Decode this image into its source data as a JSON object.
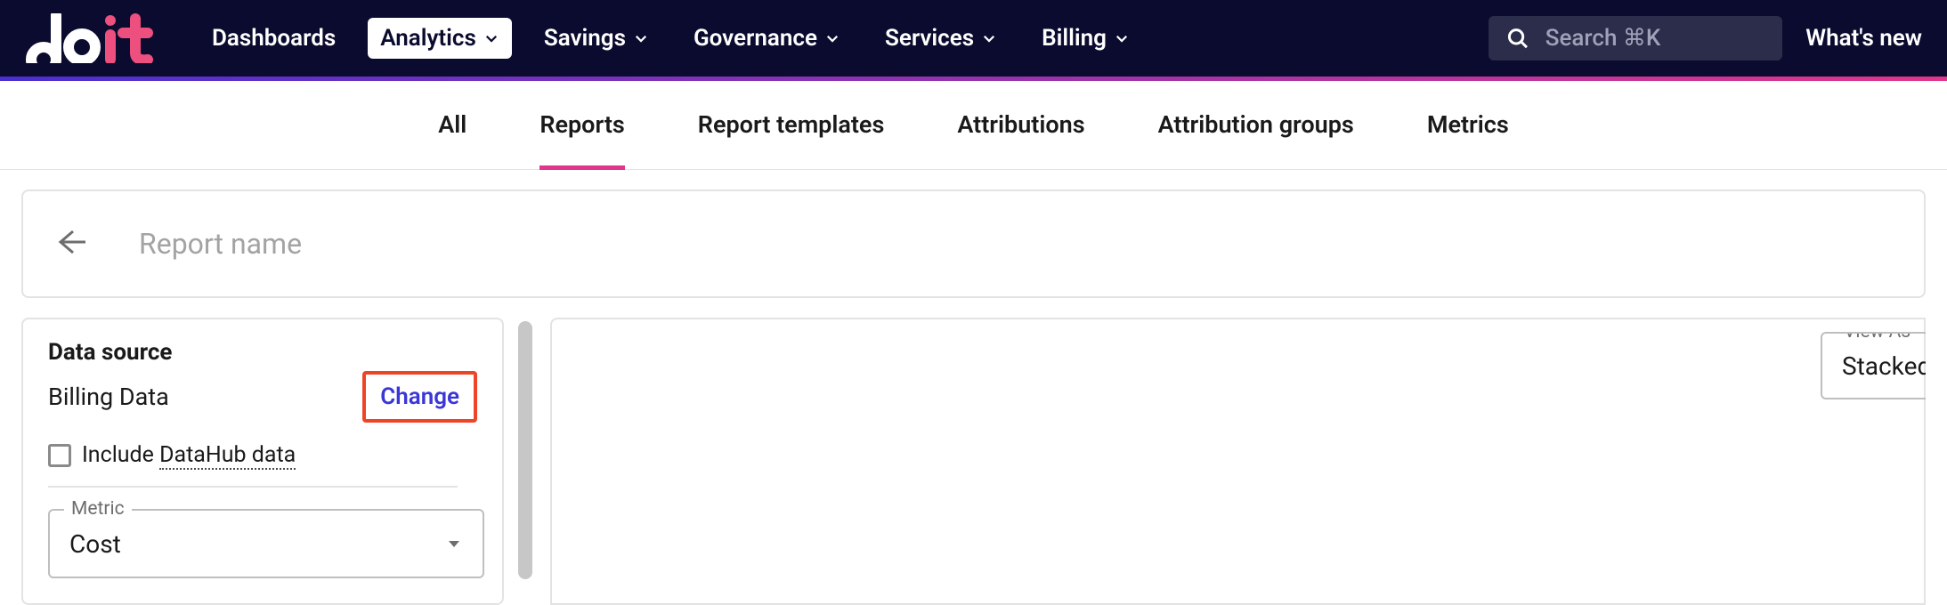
{
  "header": {
    "nav": [
      {
        "label": "Dashboards",
        "dropdown": false
      },
      {
        "label": "Analytics",
        "dropdown": true,
        "active": true
      },
      {
        "label": "Savings",
        "dropdown": true
      },
      {
        "label": "Governance",
        "dropdown": true
      },
      {
        "label": "Services",
        "dropdown": true
      },
      {
        "label": "Billing",
        "dropdown": true
      }
    ],
    "search_placeholder": "Search ⌘K",
    "whats_new": "What's new"
  },
  "subtabs": [
    {
      "label": "All"
    },
    {
      "label": "Reports",
      "active": true
    },
    {
      "label": "Report templates"
    },
    {
      "label": "Attributions"
    },
    {
      "label": "Attribution groups"
    },
    {
      "label": "Metrics"
    }
  ],
  "report": {
    "name_placeholder": "Report name",
    "name_value": ""
  },
  "side": {
    "data_source_title": "Data source",
    "data_source_value": "Billing Data",
    "change_label": "Change",
    "include_datahub_prefix": "Include ",
    "include_datahub_underlined": "DataHub data",
    "metric_legend": "Metric",
    "metric_value": "Cost"
  },
  "canvas": {
    "view_as_legend": "View As",
    "view_as_value": "Stacked"
  }
}
